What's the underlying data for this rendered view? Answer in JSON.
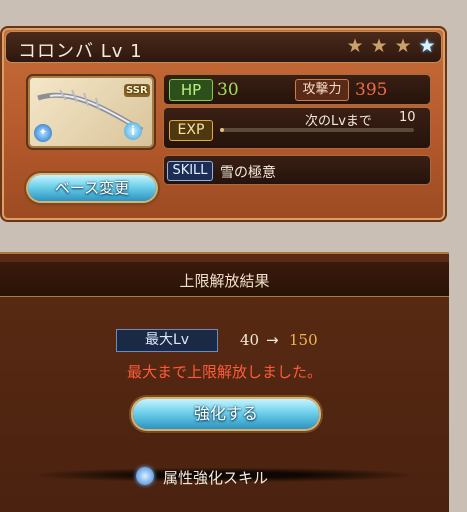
{
  "header": {
    "title": "コロンバ Lv 1",
    "stars": [
      "bronze-star-icon",
      "bronze-star-icon",
      "bronze-star-icon",
      "blue-star-icon"
    ]
  },
  "weapon": {
    "rarity": "SSR",
    "element_icon": "wind-element-icon",
    "info_icon": "info-icon"
  },
  "stats": {
    "hp_label": "HP",
    "hp_value": "30",
    "atk_label": "攻撃力",
    "atk_value": "395",
    "exp_label": "EXP",
    "next_label": "次のLvまで",
    "next_value": "10",
    "exp_progress": 0.0,
    "skill_label": "SKILL",
    "skill_value": "雪の極意"
  },
  "buttons": {
    "base_change": "ベース変更",
    "enhance": "強化する"
  },
  "result": {
    "title": "上限解放結果",
    "maxlv_label": "最大Lv",
    "from": "40",
    "arrow": "→",
    "to": "150",
    "message": "最大まで上限解放しました。",
    "skill_up": "属性強化スキル"
  },
  "colors": {
    "accent_red": "#ff5b3a",
    "hp_green": "#9be25b",
    "atk_red": "#f06a45",
    "lv_gold": "#f3b24e"
  }
}
